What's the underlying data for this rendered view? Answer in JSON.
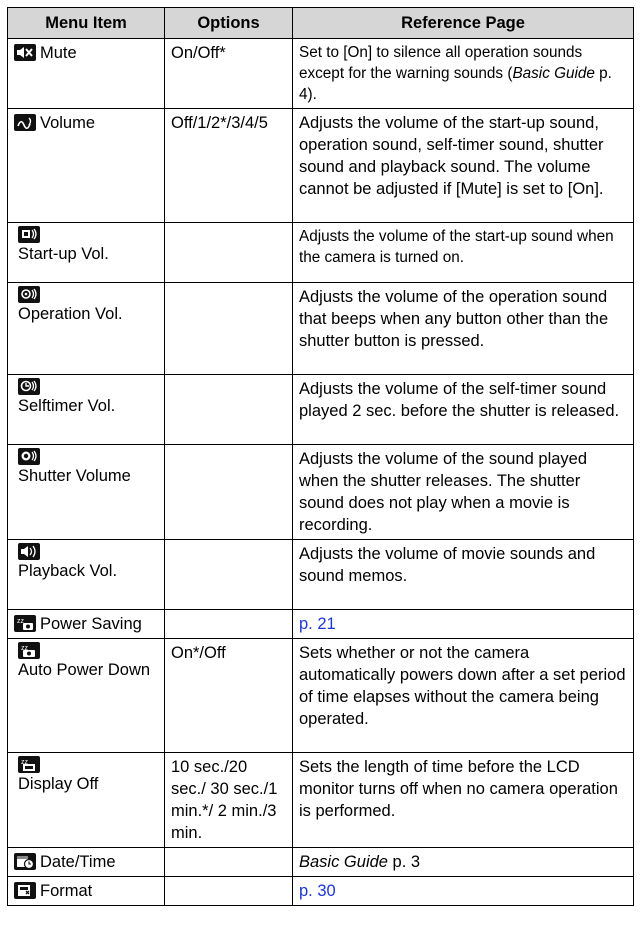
{
  "headers": {
    "menu_item": "Menu Item",
    "options": "Options",
    "reference_page": "Reference Page"
  },
  "rows": [
    {
      "label": "Mute",
      "icon": "mute-icon",
      "options": "On/Off*",
      "ref": "Set to [On] to silence all operation sounds except for the warning sounds (",
      "ref_italic": "Basic Guide",
      "ref_tail": " p. 4)."
    },
    {
      "label": "Volume",
      "icon": "volume-icon",
      "options": "Off/1/2*/3/4/5",
      "ref": "Adjusts the volume of the start-up sound, operation sound, self-timer sound, shutter sound and playback sound. The volume cannot be adjusted if [Mute] is set to [On]."
    },
    {
      "label": "Start-up Vol.",
      "icon": "startup-volume-icon",
      "options": "",
      "ref": "Adjusts the volume of the start-up sound when the camera is turned on."
    },
    {
      "label": "Operation Vol.",
      "icon": "operation-volume-icon",
      "options": "",
      "ref": "Adjusts the volume of the operation sound that beeps when any button other than the shutter button is pressed."
    },
    {
      "label": "Selftimer Vol.",
      "icon": "selftimer-volume-icon",
      "options": "",
      "ref": "Adjusts the volume of the self-timer sound played 2 sec. before the shutter is released."
    },
    {
      "label": "Shutter Volume",
      "icon": "shutter-volume-icon",
      "options": "",
      "ref": "Adjusts the volume of the sound played when the shutter releases. The shutter sound does not play when a movie is recording."
    },
    {
      "label": "Playback Vol.",
      "icon": "playback-volume-icon",
      "options": "",
      "ref": "Adjusts the volume of movie sounds and sound memos."
    },
    {
      "label": "Power Saving",
      "icon": "power-saving-icon",
      "options": "",
      "ref": "p. 21"
    },
    {
      "label": "Auto Power Down",
      "icon": "auto-power-down-icon",
      "options": "On*/Off",
      "ref": "Sets whether or not the camera automatically powers down after a set period of time elapses without the camera being operated."
    },
    {
      "label": "Display Off",
      "icon": "display-off-icon",
      "options": "10 sec./20 sec./ 30 sec./1 min.*/ 2 min./3 min.",
      "ref": "Sets the length of time before the LCD monitor turns off when no camera operation is performed."
    },
    {
      "label": "Date/Time",
      "icon": "date-time-icon",
      "options": "",
      "ref_italic": "Basic Guide",
      "ref_tail": " p. 3"
    },
    {
      "label": "Format",
      "icon": "format-icon",
      "options": "",
      "ref": "p. 30"
    }
  ]
}
